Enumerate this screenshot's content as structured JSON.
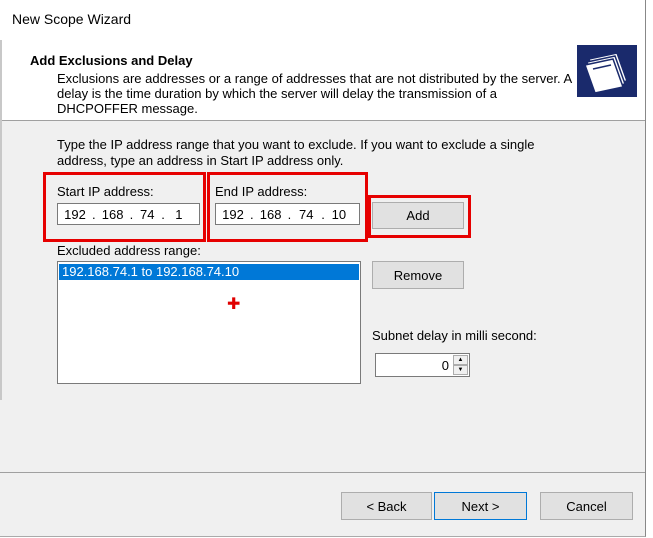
{
  "window": {
    "title": "New Scope Wizard"
  },
  "header": {
    "title": "Add Exclusions and Delay",
    "description": "Exclusions are addresses or a range of addresses that are not distributed by the server. A delay is the time duration by which the server will delay the transmission of a DHCPOFFER message.",
    "icon": "wizard-folders-icon"
  },
  "instructions": "Type the IP address range that you want to exclude. If you want to exclude a single address, type an address in Start IP address only.",
  "start_ip": {
    "label": "Start IP address:",
    "octets": [
      "192",
      "168",
      "74",
      "1"
    ]
  },
  "end_ip": {
    "label": "End IP address:",
    "octets": [
      "192",
      "168",
      "74",
      "10"
    ]
  },
  "buttons": {
    "add": "Add",
    "remove": "Remove",
    "back": "< Back",
    "next": "Next >",
    "cancel": "Cancel"
  },
  "excluded": {
    "label": "Excluded address range:",
    "items": [
      "192.168.74.1 to 192.168.74.10"
    ]
  },
  "delay": {
    "label": "Subnet delay in milli second:",
    "value": "0"
  },
  "colors": {
    "highlight": "#e60000",
    "selection": "#0078d7"
  }
}
